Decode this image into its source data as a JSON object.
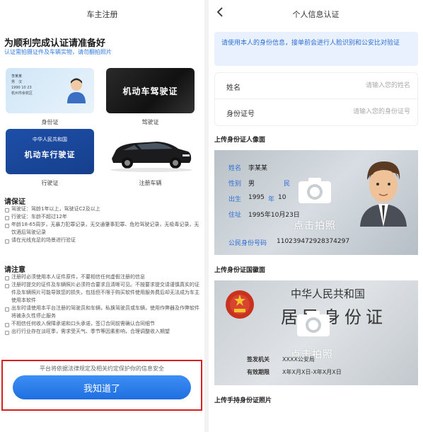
{
  "left": {
    "title": "车主注册",
    "heading": "为顺利完成认证请准备好",
    "subheading": "认证需拍摄证件及车辆实物，请勿翻拍照片",
    "certs": [
      {
        "label": "身份证",
        "card_text": "",
        "card_text2": ""
      },
      {
        "label": "驾驶证",
        "card_text": "机动车驾驶证",
        "card_text2": ""
      },
      {
        "label": "行驶证",
        "card_text": "中华人民共和国",
        "card_text2": "机动车行驶证"
      },
      {
        "label": "注册车辆",
        "card_text": "",
        "card_text2": ""
      }
    ],
    "guarantee_title": "请保证",
    "guarantee_items": [
      "驾驶证：驾龄1年以上，驾驶证C2及以上",
      "行驶证：车龄不超过12年",
      "年龄18-65周岁，无暴力犯罪记录，无交通肇事犯罪、危险驾驶记录，无吸毒记录，无饮酒后驾驶记录",
      "请在光线充足的场景进行验证"
    ],
    "notice_title": "请注意",
    "notice_items": [
      "注册时必须使用本人证件原件，不要相信任何虚假注册的信息",
      "注册时提交的证件及车辆照片必须符合要求且清晰可见。不按要求提交请谨慎真实的证件及车辆照片可能导致您的损失，包括但不限于购买软件使用服务费后却无法成为车主使用本软件",
      "出车时请使用本平台注册的驾驶员和车辆，私换驾驶员或车辆，使用作弊器及作弊软件将被永久性停止服务",
      "不相信任何收入保障承诺和口头承诺，签订合同前需确认合同细节",
      "出行行业存在淡旺季，需求受天气、季节等因素影响，合理调整收入期望"
    ],
    "footer_note": "平台将依据法律规定及相关约定保护你的信息安全",
    "ok_button": "我知道了",
    "id_card_lines": [
      "李某某",
      "男　汉",
      "1990 10 23",
      "杭州市余杭区"
    ]
  },
  "right": {
    "title": "个人信息认证",
    "notice": "请使用本人的身份信息，接单前会进行人脸识别和公安比对验证",
    "form": {
      "name_label": "姓名",
      "name_placeholder": "请输入您的姓名",
      "id_label": "身份证号",
      "id_placeholder": "请输入您的身份证号"
    },
    "upload_front_title": "上传身份证人像面",
    "front": {
      "name_label": "姓名",
      "name_value": "李某某",
      "gender_label": "性别",
      "gender_value": "男",
      "ethnic_label": "民",
      "birth_label": "出生",
      "birth_year": "1995",
      "year_char": "年",
      "birth_rest": "10",
      "address_label": "住址",
      "address_value": "1995年10月23日",
      "idno_label": "公民身份号码",
      "idno_value": "110239472928374297",
      "action": "点击拍照"
    },
    "upload_back_title": "上传身份证国徽面",
    "back": {
      "country": "中华人民共和国",
      "card_name": "居民身份证",
      "issuer_label": "签发机关",
      "issuer_value": "XXXX公安局",
      "validity_label": "有效期限",
      "validity_value": "X年X月X日-X年X月X日",
      "action": "点击拍照"
    },
    "upload_hand_title": "上传手持身份证照片"
  },
  "colors": {
    "accent": "#2f7be0",
    "button": "#1f6fe0",
    "highlight_border": "#d62020",
    "notice_bg": "#e8f1fd"
  }
}
